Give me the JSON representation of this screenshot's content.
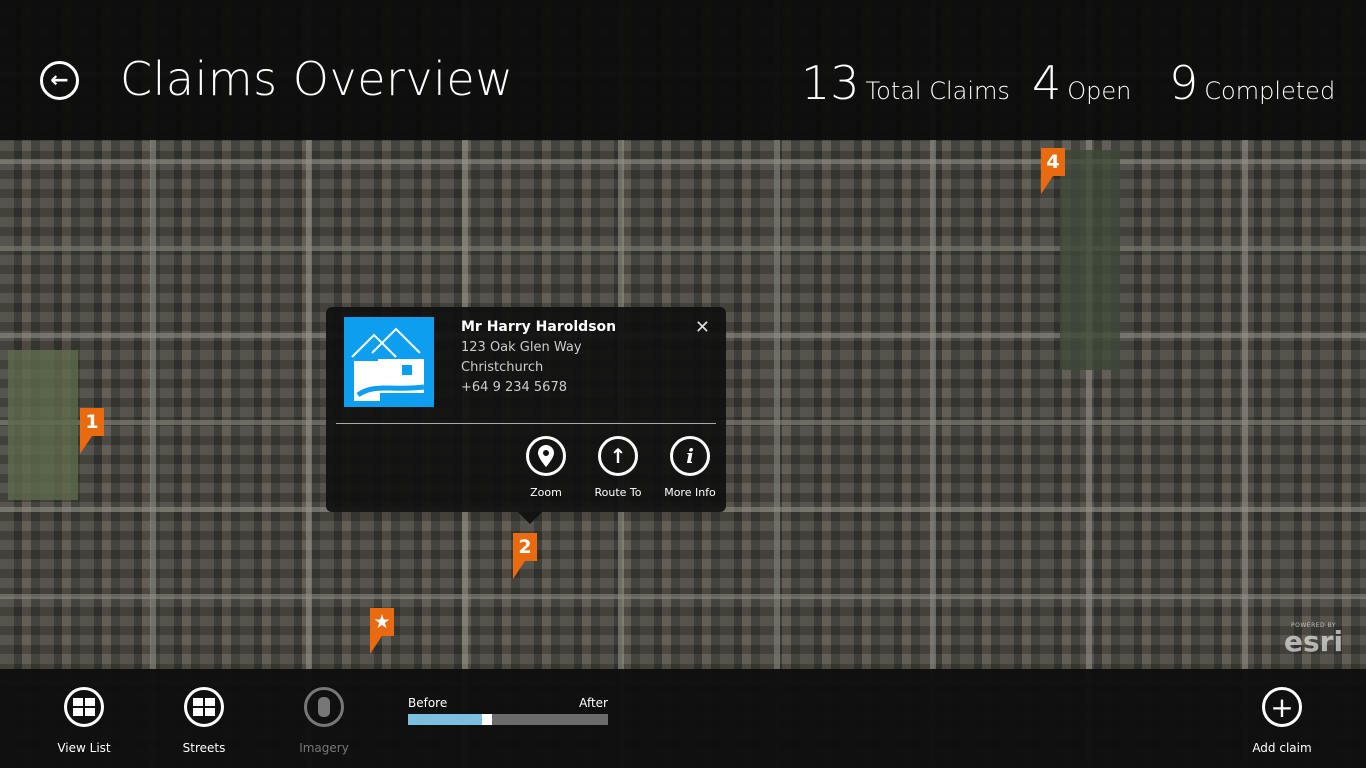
{
  "header": {
    "title": "Claims Overview",
    "stats": [
      {
        "value": "13",
        "label": "Total Claims"
      },
      {
        "value": "4",
        "label": "Open"
      },
      {
        "value": "9",
        "label": "Completed"
      }
    ]
  },
  "popup": {
    "name": "Mr Harry Haroldson",
    "address_line1": "123 Oak Glen Way",
    "address_line2": "Christchurch",
    "phone": "+64 9 234 5678",
    "close": "✕",
    "actions": [
      {
        "label": "Zoom",
        "icon": "map-pin-icon"
      },
      {
        "label": "Route To",
        "icon": "arrow-up-icon"
      },
      {
        "label": "More Info",
        "icon": "info-icon"
      }
    ]
  },
  "markers": [
    {
      "label": "1"
    },
    {
      "label": "2"
    },
    {
      "label": "★"
    },
    {
      "label": "4"
    }
  ],
  "attribution": {
    "powered": "POWERED BY",
    "brand": "esri"
  },
  "appbar": {
    "view_list": "View List",
    "streets": "Streets",
    "imagery": "Imagery",
    "add_claim": "Add claim"
  },
  "slider": {
    "before": "Before",
    "after": "After",
    "value_percent": 37,
    "colors": {
      "fill": "#7bbede",
      "track": "#6b6b6b"
    }
  }
}
